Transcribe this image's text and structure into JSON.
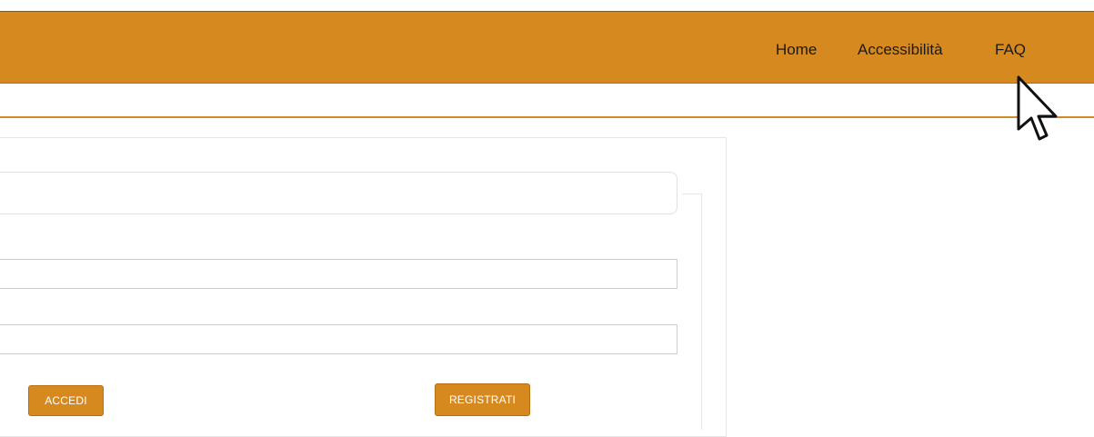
{
  "header": {
    "nav": {
      "home": "Home",
      "accessibility": "Accessibilità",
      "faq": "FAQ"
    }
  },
  "form": {
    "field1_value": "",
    "field1_placeholder": "",
    "field2_value": "",
    "field2_placeholder": "",
    "buttons": {
      "accedi": "ACCEDI",
      "registrati": "REGISTRATI"
    }
  },
  "colors": {
    "brand": "#D6891F",
    "text_dark": "#1b1b1b",
    "border_light": "#e6e6e6"
  },
  "icons": {
    "cursor": "mouse-pointer-icon"
  }
}
